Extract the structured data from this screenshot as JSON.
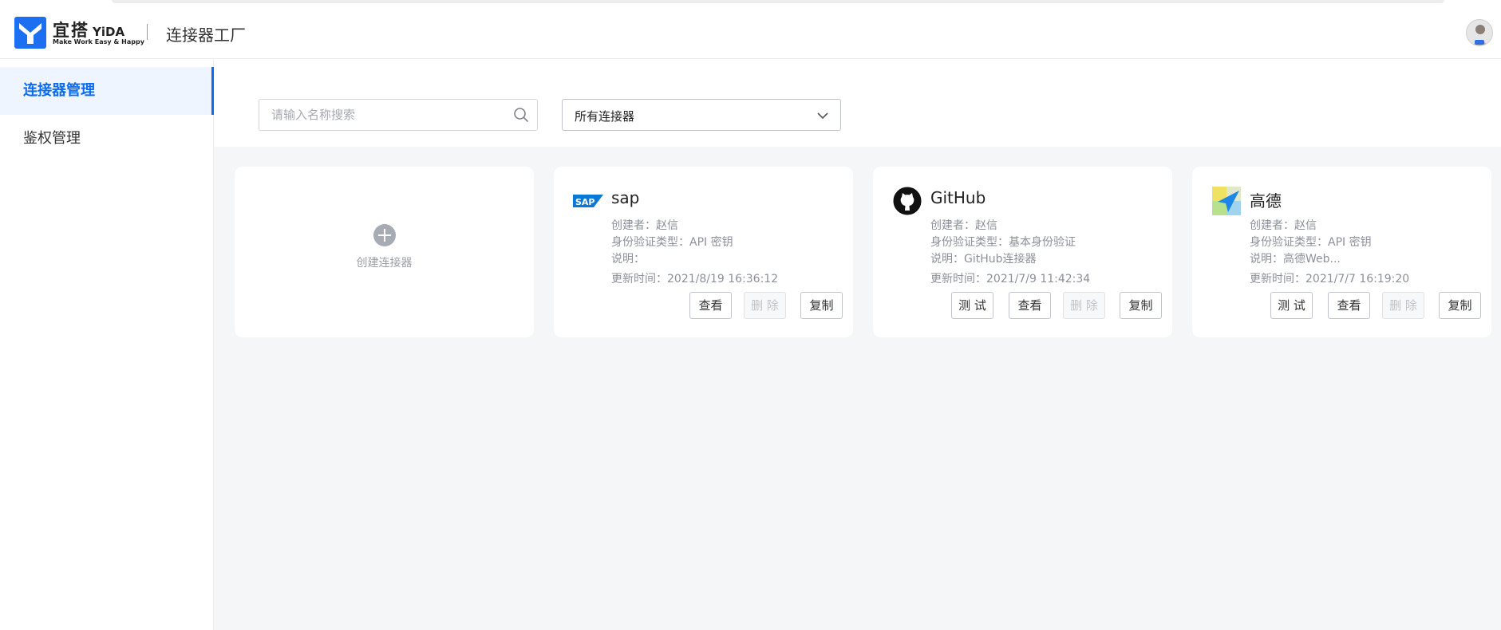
{
  "header": {
    "brand_cn": "宜搭",
    "brand_en": "YiDA",
    "brand_slogan": "Make Work Easy & Happy",
    "app_title": "连接器工厂"
  },
  "sidebar": {
    "items": [
      {
        "label": "连接器管理",
        "active": true
      },
      {
        "label": "鉴权管理",
        "active": false
      }
    ]
  },
  "filters": {
    "search_placeholder": "请输入名称搜索",
    "select_value": "所有连接器"
  },
  "create_card": {
    "label": "创建连接器"
  },
  "cards": [
    {
      "name": "sap",
      "icon": "sap-logo-icon",
      "creator": "创建者：赵信",
      "auth": "身份验证类型：API 密钥",
      "desc": "说明：",
      "updated": "更新时间：2021/8/19 16:36:12",
      "buttons": {
        "view": "查看",
        "delete": "删 除",
        "copy": "复制"
      }
    },
    {
      "name": "GitHub",
      "icon": "github-logo-icon",
      "creator": "创建者：赵信",
      "auth": "身份验证类型：基本身份验证",
      "desc": "说明：GitHub连接器",
      "updated": "更新时间：2021/7/9 11:42:34",
      "buttons": {
        "test": "测 试",
        "view": "查看",
        "delete": "删 除",
        "copy": "复制"
      }
    },
    {
      "name": "高德",
      "icon": "amap-logo-icon",
      "creator": "创建者：赵信",
      "auth": "身份验证类型：API 密钥",
      "desc": "说明：高德Web...",
      "updated": "更新时间：2021/7/7 16:19:20",
      "buttons": {
        "test": "测 试",
        "view": "查看",
        "delete": "删 除",
        "copy": "复制"
      }
    }
  ],
  "colors": {
    "accent": "#0d6bef",
    "background": "#f5f6f8"
  }
}
